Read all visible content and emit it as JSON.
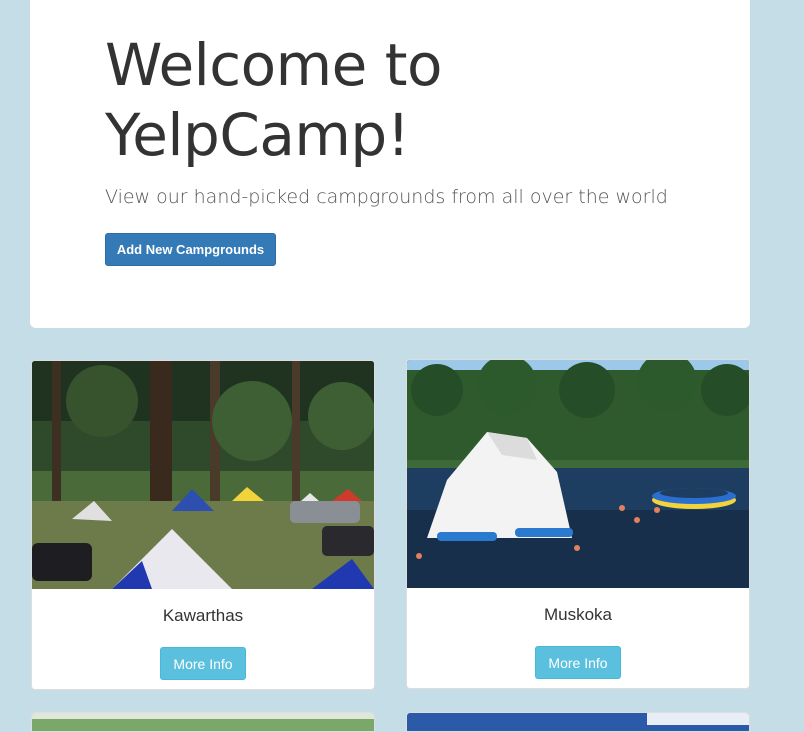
{
  "jumbotron": {
    "title": "Welcome to YelpCamp!",
    "subtitle": "View our hand-picked campgrounds from all over the world",
    "add_button_label": "Add New Campgrounds"
  },
  "campgrounds": [
    {
      "name": "Kawarthas",
      "button_label": "More Info",
      "image": "campsite-with-tents-photo"
    },
    {
      "name": "Muskoka",
      "button_label": "More Info",
      "image": "lake-inflatable-photo"
    }
  ],
  "colors": {
    "background": "#c5dde6",
    "primary": "#337ab7",
    "info": "#5bc0de"
  }
}
